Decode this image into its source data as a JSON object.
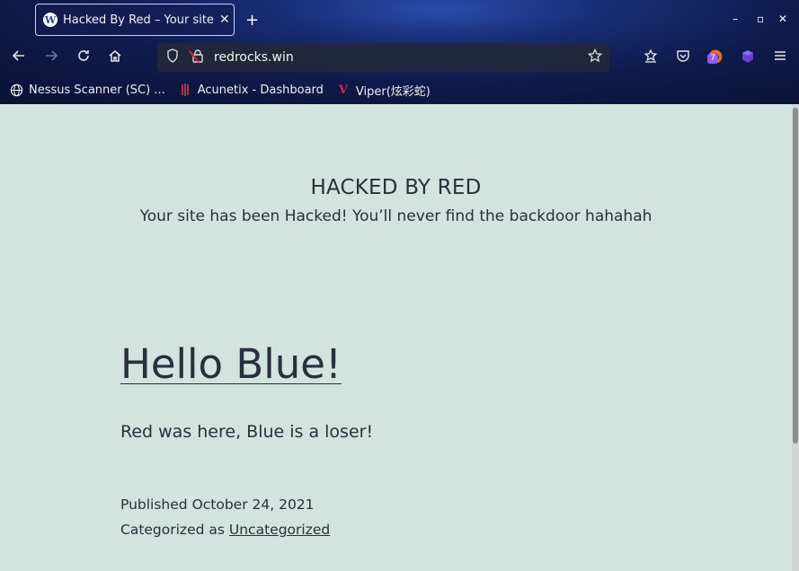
{
  "browser": {
    "tab": {
      "title": "Hacked By Red – Your site has been Hacked!",
      "close_glyph": "✕"
    },
    "new_tab_glyph": "+",
    "window_controls": {
      "minimize": "–",
      "maximize": "▫",
      "close": "✕"
    },
    "url": "redrocks.win",
    "extension_badge": "7",
    "bookmarks": [
      {
        "label": "Nessus Scanner (SC) ...",
        "icon": "globe-icon"
      },
      {
        "label": "Acunetix - Dashboard",
        "icon": "acunetix-icon"
      },
      {
        "label": "Viper(炫彩蛇)",
        "icon": "viper-icon"
      }
    ]
  },
  "site": {
    "title": "HACKED BY RED",
    "description": "Your site has been Hacked! You’ll never find the backdoor hahahah"
  },
  "post": {
    "title": "Hello Blue!",
    "body": "Red was here, Blue is a loser!",
    "published_label": "Published",
    "published_date": "October 24, 2021",
    "category_label": "Categorized as",
    "category": "Uncategorized"
  },
  "colors": {
    "page_bg": "#d1e4dd",
    "text": "#28303d",
    "accent_purple": "#9059ff"
  }
}
